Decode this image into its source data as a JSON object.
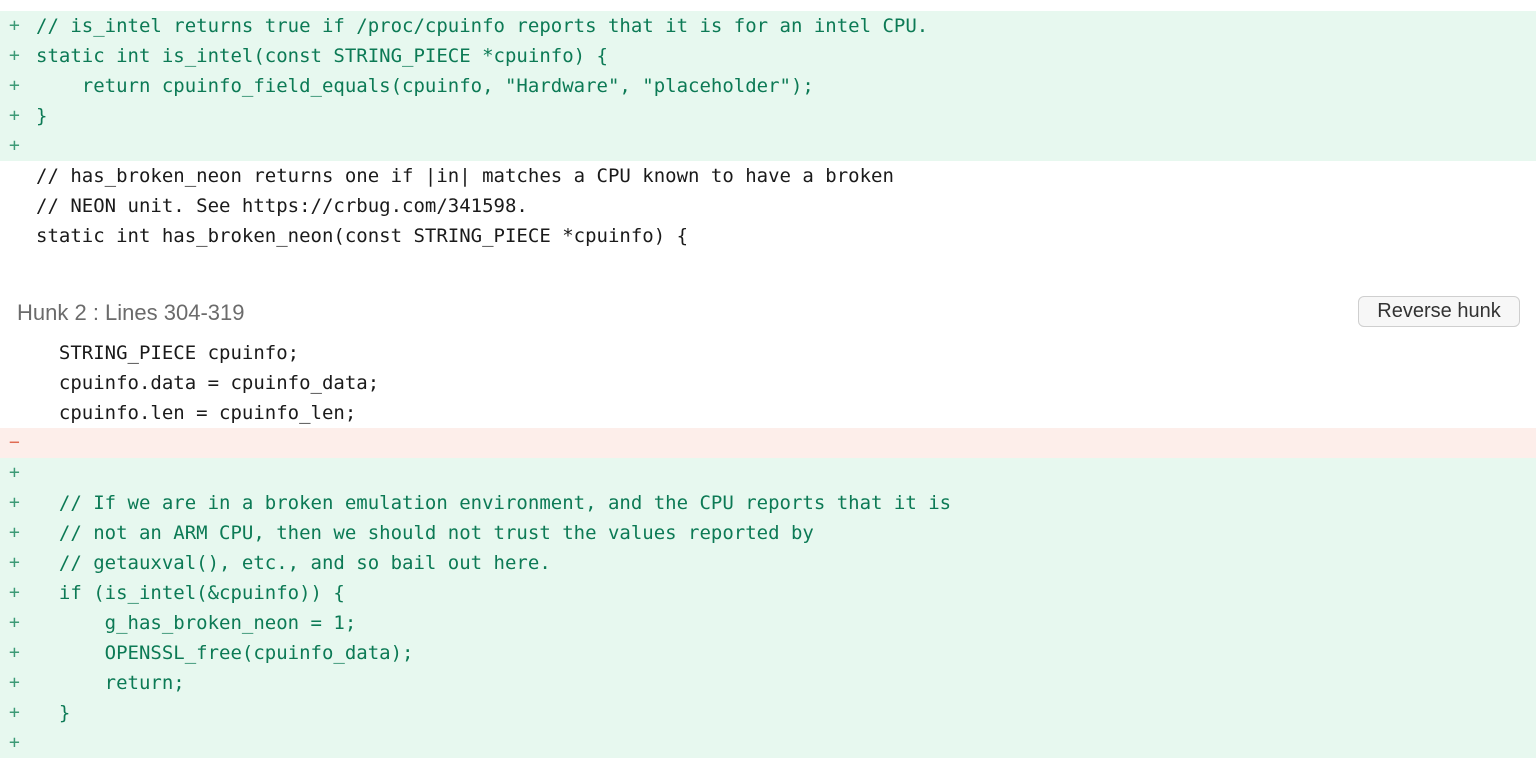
{
  "diff": {
    "hunk1": {
      "lines": [
        {
          "type": "add",
          "marker": "+",
          "code": "// is_intel returns true if /proc/cpuinfo reports that it is for an intel CPU."
        },
        {
          "type": "add",
          "marker": "+",
          "code": "static int is_intel(const STRING_PIECE *cpuinfo) {"
        },
        {
          "type": "add",
          "marker": "+",
          "code": "    return cpuinfo_field_equals(cpuinfo, \"Hardware\", \"placeholder\");"
        },
        {
          "type": "add",
          "marker": "+",
          "code": "}"
        },
        {
          "type": "add",
          "marker": "+",
          "code": ""
        },
        {
          "type": "ctx",
          "marker": "",
          "code": "// has_broken_neon returns one if |in| matches a CPU known to have a broken"
        },
        {
          "type": "ctx",
          "marker": "",
          "code": "// NEON unit. See https://crbug.com/341598."
        },
        {
          "type": "ctx",
          "marker": "",
          "code": "static int has_broken_neon(const STRING_PIECE *cpuinfo) {"
        }
      ]
    },
    "hunk2": {
      "title": "Hunk 2 : Lines 304-319",
      "reverse_label": "Reverse hunk",
      "lines": [
        {
          "type": "ctx",
          "marker": "",
          "code": "  STRING_PIECE cpuinfo;"
        },
        {
          "type": "ctx",
          "marker": "",
          "code": "  cpuinfo.data = cpuinfo_data;"
        },
        {
          "type": "ctx",
          "marker": "",
          "code": "  cpuinfo.len = cpuinfo_len;"
        },
        {
          "type": "del",
          "marker": "−",
          "code": ""
        },
        {
          "type": "add",
          "marker": "+",
          "code": ""
        },
        {
          "type": "add",
          "marker": "+",
          "code": "  // If we are in a broken emulation environment, and the CPU reports that it is"
        },
        {
          "type": "add",
          "marker": "+",
          "code": "  // not an ARM CPU, then we should not trust the values reported by"
        },
        {
          "type": "add",
          "marker": "+",
          "code": "  // getauxval(), etc., and so bail out here."
        },
        {
          "type": "add",
          "marker": "+",
          "code": "  if (is_intel(&cpuinfo)) {"
        },
        {
          "type": "add",
          "marker": "+",
          "code": "      g_has_broken_neon = 1;"
        },
        {
          "type": "add",
          "marker": "+",
          "code": "      OPENSSL_free(cpuinfo_data);"
        },
        {
          "type": "add",
          "marker": "+",
          "code": "      return;"
        },
        {
          "type": "add",
          "marker": "+",
          "code": "  }"
        },
        {
          "type": "add",
          "marker": "+",
          "code": ""
        }
      ]
    }
  },
  "colors": {
    "added_bg": "#e7f8ef",
    "added_text": "#0c7a55",
    "removed_bg": "#fdeeea",
    "removed_text": "#d25c45",
    "context_text": "#1a1a1a"
  }
}
